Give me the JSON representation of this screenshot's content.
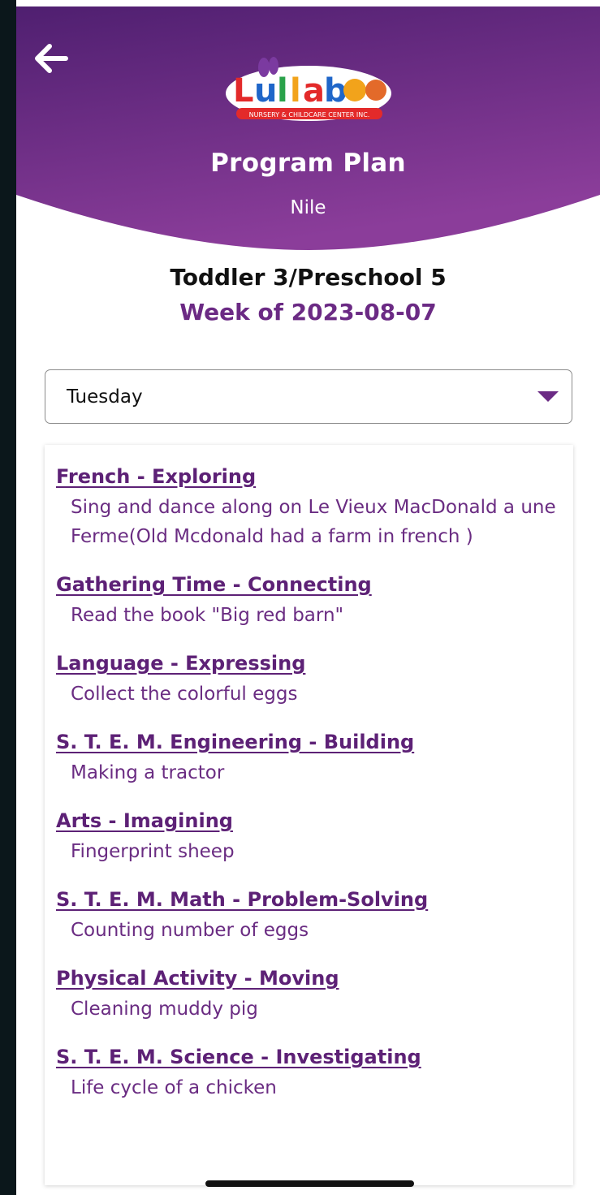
{
  "header": {
    "title": "Program Plan",
    "subtitle": "Nile",
    "back_icon": "arrow-left-icon",
    "gradient": [
      "#4f1f70",
      "#8b3d9a"
    ]
  },
  "logo": {
    "text": "Lullaboo",
    "tagline": "NURSERY & CHILDCARE CENTER INC."
  },
  "class_name": "Toddler 3/Preschool 5",
  "week_label": "Week of 2023-08-07",
  "day_select": {
    "value": "Tuesday",
    "icon": "caret-down-icon"
  },
  "activities": [
    {
      "title": "French - Exploring",
      "desc": "Sing and dance along on Le Vieux MacDonald a une Ferme(Old Mcdonald had a farm in french )"
    },
    {
      "title": "Gathering Time - Connecting",
      "desc": "Read the book \"Big red barn\""
    },
    {
      "title": "Language - Expressing",
      "desc": "Collect the colorful eggs"
    },
    {
      "title": "S. T. E. M.  Engineering - Building",
      "desc": "Making a tractor"
    },
    {
      "title": "Arts - Imagining",
      "desc": "Fingerprint sheep"
    },
    {
      "title": "S. T. E. M. Math - Problem-Solving",
      "desc": "Counting number of eggs"
    },
    {
      "title": "Physical Activity - Moving",
      "desc": "Cleaning muddy pig"
    },
    {
      "title": "S. T. E. M. Science - Investigating",
      "desc": "Life cycle of a chicken"
    }
  ],
  "colors": {
    "accent": "#6b2a84",
    "title_text": "#5d2176"
  }
}
